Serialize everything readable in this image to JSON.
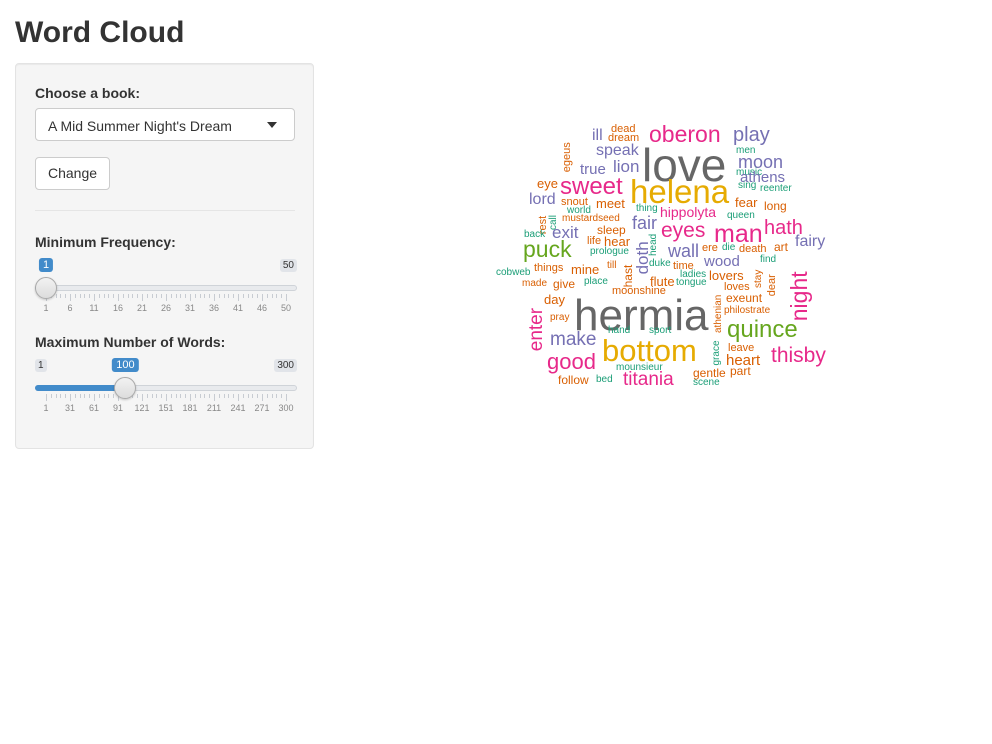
{
  "app": {
    "title": "Word Cloud"
  },
  "sidebar": {
    "book": {
      "label": "Choose a book:",
      "selected": "A Mid Summer Night's Dream"
    },
    "change_button": "Change",
    "min_freq": {
      "label": "Minimum Frequency:",
      "min": "1",
      "max": "50",
      "value": "1",
      "range": [
        1,
        50
      ],
      "current": 1,
      "labels": [
        "1",
        "6",
        "11",
        "16",
        "21",
        "26",
        "31",
        "36",
        "41",
        "46",
        "50"
      ]
    },
    "max_words": {
      "label": "Maximum Number of Words:",
      "min": "1",
      "max": "300",
      "value": "100",
      "range": [
        1,
        300
      ],
      "current": 100,
      "labels": [
        "1",
        "31",
        "61",
        "91",
        "121",
        "151",
        "181",
        "211",
        "241",
        "271",
        "300"
      ]
    }
  },
  "colors": {
    "pink": "#e7298a",
    "orange": "#d95f02",
    "purple": "#7570b3",
    "teal": "#1b9e77",
    "green": "#66a61e",
    "gold": "#e6ab02",
    "gray": "#666666"
  },
  "cloud": {
    "words": [
      {
        "text": "love",
        "color": "gray"
      },
      {
        "text": "hermia",
        "color": "gray"
      },
      {
        "text": "helena",
        "color": "gold"
      },
      {
        "text": "bottom",
        "color": "gold"
      },
      {
        "text": "oberon",
        "color": "pink"
      },
      {
        "text": "play",
        "color": "purple"
      },
      {
        "text": "ill",
        "color": "purple"
      },
      {
        "text": "dead",
        "color": "orange"
      },
      {
        "text": "dream",
        "color": "orange"
      },
      {
        "text": "speak",
        "color": "purple"
      },
      {
        "text": "men",
        "color": "teal"
      },
      {
        "text": "moon",
        "color": "purple"
      },
      {
        "text": "true",
        "color": "purple"
      },
      {
        "text": "lion",
        "color": "purple"
      },
      {
        "text": "egeus",
        "color": "orange"
      },
      {
        "text": "music",
        "color": "teal"
      },
      {
        "text": "athens",
        "color": "purple"
      },
      {
        "text": "sweet",
        "color": "pink"
      },
      {
        "text": "eye",
        "color": "orange"
      },
      {
        "text": "sing",
        "color": "teal"
      },
      {
        "text": "reenter",
        "color": "teal"
      },
      {
        "text": "lord",
        "color": "purple"
      },
      {
        "text": "snout",
        "color": "orange"
      },
      {
        "text": "meet",
        "color": "orange"
      },
      {
        "text": "fear",
        "color": "orange"
      },
      {
        "text": "long",
        "color": "orange"
      },
      {
        "text": "world",
        "color": "teal"
      },
      {
        "text": "thing",
        "color": "teal"
      },
      {
        "text": "hippolyta",
        "color": "pink"
      },
      {
        "text": "queen",
        "color": "teal"
      },
      {
        "text": "rest",
        "color": "orange"
      },
      {
        "text": "call",
        "color": "teal"
      },
      {
        "text": "mustardseed",
        "color": "orange"
      },
      {
        "text": "fair",
        "color": "purple"
      },
      {
        "text": "eyes",
        "color": "pink"
      },
      {
        "text": "man",
        "color": "pink"
      },
      {
        "text": "hath",
        "color": "pink"
      },
      {
        "text": "exit",
        "color": "purple"
      },
      {
        "text": "sleep",
        "color": "orange"
      },
      {
        "text": "back",
        "color": "teal"
      },
      {
        "text": "life",
        "color": "orange"
      },
      {
        "text": "hear",
        "color": "orange"
      },
      {
        "text": "puck",
        "color": "green"
      },
      {
        "text": "head",
        "color": "teal"
      },
      {
        "text": "doth",
        "color": "purple"
      },
      {
        "text": "wall",
        "color": "purple"
      },
      {
        "text": "ere",
        "color": "orange"
      },
      {
        "text": "die",
        "color": "teal"
      },
      {
        "text": "death",
        "color": "orange"
      },
      {
        "text": "art",
        "color": "orange"
      },
      {
        "text": "fairy",
        "color": "purple"
      },
      {
        "text": "prologue",
        "color": "teal"
      },
      {
        "text": "duke",
        "color": "teal"
      },
      {
        "text": "wood",
        "color": "purple"
      },
      {
        "text": "find",
        "color": "teal"
      },
      {
        "text": "night",
        "color": "pink"
      },
      {
        "text": "things",
        "color": "orange"
      },
      {
        "text": "mine",
        "color": "orange"
      },
      {
        "text": "till",
        "color": "orange"
      },
      {
        "text": "hast",
        "color": "orange"
      },
      {
        "text": "time",
        "color": "orange"
      },
      {
        "text": "stay",
        "color": "orange"
      },
      {
        "text": "cobweb",
        "color": "teal"
      },
      {
        "text": "ladies",
        "color": "teal"
      },
      {
        "text": "lovers",
        "color": "orange"
      },
      {
        "text": "made",
        "color": "orange"
      },
      {
        "text": "give",
        "color": "orange"
      },
      {
        "text": "place",
        "color": "teal"
      },
      {
        "text": "flute",
        "color": "orange"
      },
      {
        "text": "tongue",
        "color": "teal"
      },
      {
        "text": "dear",
        "color": "orange"
      },
      {
        "text": "loves",
        "color": "orange"
      },
      {
        "text": "moonshine",
        "color": "orange"
      },
      {
        "text": "athenian",
        "color": "orange"
      },
      {
        "text": "exeunt",
        "color": "orange"
      },
      {
        "text": "enter",
        "color": "pink"
      },
      {
        "text": "day",
        "color": "orange"
      },
      {
        "text": "philostrate",
        "color": "orange"
      },
      {
        "text": "pray",
        "color": "orange"
      },
      {
        "text": "quince",
        "color": "green"
      },
      {
        "text": "hand",
        "color": "teal"
      },
      {
        "text": "sport",
        "color": "teal"
      },
      {
        "text": "make",
        "color": "purple"
      },
      {
        "text": "grace",
        "color": "teal"
      },
      {
        "text": "leave",
        "color": "orange"
      },
      {
        "text": "thisby",
        "color": "pink"
      },
      {
        "text": "good",
        "color": "pink"
      },
      {
        "text": "heart",
        "color": "orange"
      },
      {
        "text": "mounsieur",
        "color": "teal"
      },
      {
        "text": "gentle",
        "color": "orange"
      },
      {
        "text": "part",
        "color": "orange"
      },
      {
        "text": "follow",
        "color": "orange"
      },
      {
        "text": "bed",
        "color": "teal"
      },
      {
        "text": "titania",
        "color": "pink"
      },
      {
        "text": "scene",
        "color": "teal"
      }
    ]
  }
}
